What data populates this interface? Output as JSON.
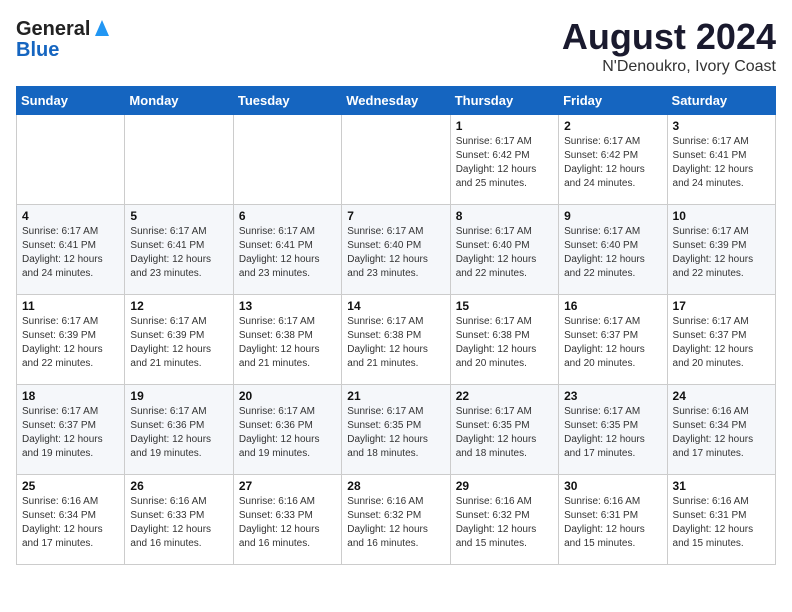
{
  "header": {
    "logo_general": "General",
    "logo_blue": "Blue",
    "title": "August 2024",
    "subtitle": "N'Denoukro, Ivory Coast"
  },
  "days_of_week": [
    "Sunday",
    "Monday",
    "Tuesday",
    "Wednesday",
    "Thursday",
    "Friday",
    "Saturday"
  ],
  "weeks": [
    [
      {
        "day": "",
        "info": ""
      },
      {
        "day": "",
        "info": ""
      },
      {
        "day": "",
        "info": ""
      },
      {
        "day": "",
        "info": ""
      },
      {
        "day": "1",
        "info": "Sunrise: 6:17 AM\nSunset: 6:42 PM\nDaylight: 12 hours\nand 25 minutes."
      },
      {
        "day": "2",
        "info": "Sunrise: 6:17 AM\nSunset: 6:42 PM\nDaylight: 12 hours\nand 24 minutes."
      },
      {
        "day": "3",
        "info": "Sunrise: 6:17 AM\nSunset: 6:41 PM\nDaylight: 12 hours\nand 24 minutes."
      }
    ],
    [
      {
        "day": "4",
        "info": "Sunrise: 6:17 AM\nSunset: 6:41 PM\nDaylight: 12 hours\nand 24 minutes."
      },
      {
        "day": "5",
        "info": "Sunrise: 6:17 AM\nSunset: 6:41 PM\nDaylight: 12 hours\nand 23 minutes."
      },
      {
        "day": "6",
        "info": "Sunrise: 6:17 AM\nSunset: 6:41 PM\nDaylight: 12 hours\nand 23 minutes."
      },
      {
        "day": "7",
        "info": "Sunrise: 6:17 AM\nSunset: 6:40 PM\nDaylight: 12 hours\nand 23 minutes."
      },
      {
        "day": "8",
        "info": "Sunrise: 6:17 AM\nSunset: 6:40 PM\nDaylight: 12 hours\nand 22 minutes."
      },
      {
        "day": "9",
        "info": "Sunrise: 6:17 AM\nSunset: 6:40 PM\nDaylight: 12 hours\nand 22 minutes."
      },
      {
        "day": "10",
        "info": "Sunrise: 6:17 AM\nSunset: 6:39 PM\nDaylight: 12 hours\nand 22 minutes."
      }
    ],
    [
      {
        "day": "11",
        "info": "Sunrise: 6:17 AM\nSunset: 6:39 PM\nDaylight: 12 hours\nand 22 minutes."
      },
      {
        "day": "12",
        "info": "Sunrise: 6:17 AM\nSunset: 6:39 PM\nDaylight: 12 hours\nand 21 minutes."
      },
      {
        "day": "13",
        "info": "Sunrise: 6:17 AM\nSunset: 6:38 PM\nDaylight: 12 hours\nand 21 minutes."
      },
      {
        "day": "14",
        "info": "Sunrise: 6:17 AM\nSunset: 6:38 PM\nDaylight: 12 hours\nand 21 minutes."
      },
      {
        "day": "15",
        "info": "Sunrise: 6:17 AM\nSunset: 6:38 PM\nDaylight: 12 hours\nand 20 minutes."
      },
      {
        "day": "16",
        "info": "Sunrise: 6:17 AM\nSunset: 6:37 PM\nDaylight: 12 hours\nand 20 minutes."
      },
      {
        "day": "17",
        "info": "Sunrise: 6:17 AM\nSunset: 6:37 PM\nDaylight: 12 hours\nand 20 minutes."
      }
    ],
    [
      {
        "day": "18",
        "info": "Sunrise: 6:17 AM\nSunset: 6:37 PM\nDaylight: 12 hours\nand 19 minutes."
      },
      {
        "day": "19",
        "info": "Sunrise: 6:17 AM\nSunset: 6:36 PM\nDaylight: 12 hours\nand 19 minutes."
      },
      {
        "day": "20",
        "info": "Sunrise: 6:17 AM\nSunset: 6:36 PM\nDaylight: 12 hours\nand 19 minutes."
      },
      {
        "day": "21",
        "info": "Sunrise: 6:17 AM\nSunset: 6:35 PM\nDaylight: 12 hours\nand 18 minutes."
      },
      {
        "day": "22",
        "info": "Sunrise: 6:17 AM\nSunset: 6:35 PM\nDaylight: 12 hours\nand 18 minutes."
      },
      {
        "day": "23",
        "info": "Sunrise: 6:17 AM\nSunset: 6:35 PM\nDaylight: 12 hours\nand 17 minutes."
      },
      {
        "day": "24",
        "info": "Sunrise: 6:16 AM\nSunset: 6:34 PM\nDaylight: 12 hours\nand 17 minutes."
      }
    ],
    [
      {
        "day": "25",
        "info": "Sunrise: 6:16 AM\nSunset: 6:34 PM\nDaylight: 12 hours\nand 17 minutes."
      },
      {
        "day": "26",
        "info": "Sunrise: 6:16 AM\nSunset: 6:33 PM\nDaylight: 12 hours\nand 16 minutes."
      },
      {
        "day": "27",
        "info": "Sunrise: 6:16 AM\nSunset: 6:33 PM\nDaylight: 12 hours\nand 16 minutes."
      },
      {
        "day": "28",
        "info": "Sunrise: 6:16 AM\nSunset: 6:32 PM\nDaylight: 12 hours\nand 16 minutes."
      },
      {
        "day": "29",
        "info": "Sunrise: 6:16 AM\nSunset: 6:32 PM\nDaylight: 12 hours\nand 15 minutes."
      },
      {
        "day": "30",
        "info": "Sunrise: 6:16 AM\nSunset: 6:31 PM\nDaylight: 12 hours\nand 15 minutes."
      },
      {
        "day": "31",
        "info": "Sunrise: 6:16 AM\nSunset: 6:31 PM\nDaylight: 12 hours\nand 15 minutes."
      }
    ]
  ]
}
